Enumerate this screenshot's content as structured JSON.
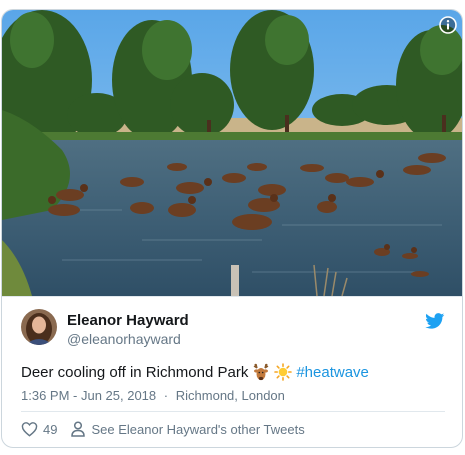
{
  "tweet": {
    "author_name": "Eleanor Hayward",
    "author_handle": "@eleanorhayward",
    "text": "Deer cooling off in Richmond Park",
    "emojis": [
      "deer-face-icon",
      "sun-icon"
    ],
    "hashtag": "#heatwave",
    "time": "1:36 PM - Jun 25, 2018",
    "separator": "·",
    "location": "Richmond, London",
    "like_count": "49",
    "see_others_label": "See Eleanor Hayward's other Tweets"
  },
  "colors": {
    "name": "#14171a",
    "secondary": "#657786",
    "link": "#1b95e0",
    "twitter_blue": "#1da1f2",
    "border": "#ccd6dd"
  }
}
